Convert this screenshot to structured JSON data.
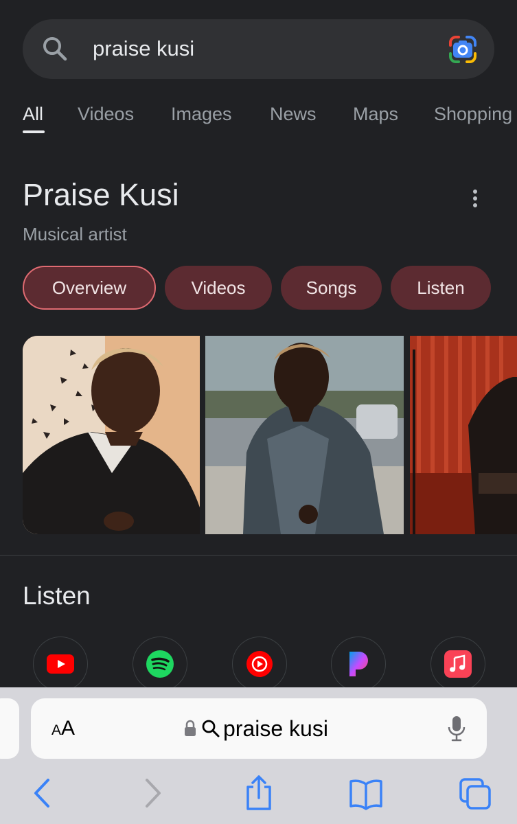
{
  "search": {
    "query": "praise kusi",
    "icon": "search-icon",
    "lens_icon": "google-lens-icon"
  },
  "tabs": [
    {
      "label": "All",
      "active": true
    },
    {
      "label": "Videos",
      "active": false
    },
    {
      "label": "Images",
      "active": false
    },
    {
      "label": "News",
      "active": false
    },
    {
      "label": "Maps",
      "active": false
    },
    {
      "label": "Shopping",
      "active": false
    }
  ],
  "knowledge_panel": {
    "title": "Praise Kusi",
    "subtitle": "Musical artist",
    "more_icon": "more-vert-icon",
    "chips": [
      {
        "label": "Overview",
        "active": true
      },
      {
        "label": "Videos",
        "active": false
      },
      {
        "label": "Songs",
        "active": false
      },
      {
        "label": "Listen",
        "active": false
      }
    ]
  },
  "listen": {
    "heading": "Listen",
    "apps": [
      "youtube-icon",
      "spotify-icon",
      "youtube-music-icon",
      "pandora-icon",
      "apple-music-icon"
    ]
  },
  "safari": {
    "aa_big": "A",
    "aa_small": "A",
    "url_text": "praise kusi",
    "toolbar": [
      "back-icon",
      "forward-icon",
      "share-icon",
      "bookmarks-icon",
      "tabs-icon"
    ]
  },
  "colors": {
    "background": "#202124",
    "chip": "#5c2b31",
    "chip_active_border": "#e06b72",
    "safari_accent": "#3a82f7"
  }
}
